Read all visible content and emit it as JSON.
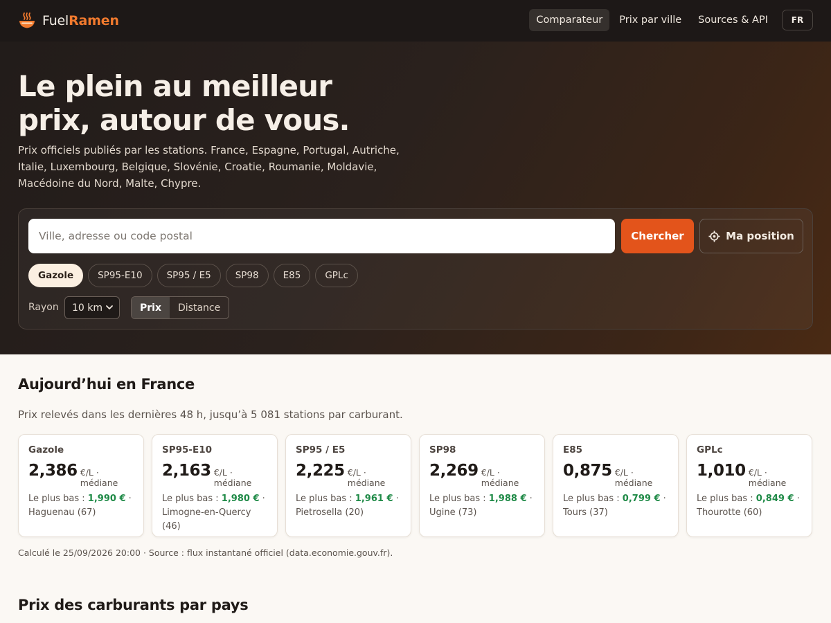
{
  "brand": {
    "name_plain": "Fuel",
    "name_highlight": "Ramen"
  },
  "nav": {
    "items": [
      {
        "label": "Comparateur",
        "active": true
      },
      {
        "label": "Prix par ville",
        "active": false
      },
      {
        "label": "Sources & API",
        "active": false
      }
    ],
    "lang": "FR"
  },
  "hero": {
    "title_line1": "Le plein au meilleur",
    "title_line2": "prix, autour de vous.",
    "subtitle": "Prix officiels publiés par les stations. France, Espagne, Portugal, Autriche, Italie, Luxembourg, Belgique, Slovénie, Croatie, Roumanie, Moldavie, Macédoine du Nord, Malte, Chypre."
  },
  "search": {
    "placeholder": "Ville, adresse ou code postal",
    "value": "",
    "submit_label": "Chercher",
    "position_label": "Ma position",
    "fuels": [
      {
        "label": "Gazole",
        "active": true
      },
      {
        "label": "SP95-E10",
        "active": false
      },
      {
        "label": "SP95 / E5",
        "active": false
      },
      {
        "label": "SP98",
        "active": false
      },
      {
        "label": "E85",
        "active": false
      },
      {
        "label": "GPLc",
        "active": false
      }
    ],
    "radius_label": "Rayon",
    "radius_value": "10 km",
    "sort_options": [
      {
        "label": "Prix",
        "active": true
      },
      {
        "label": "Distance",
        "active": false
      }
    ]
  },
  "today": {
    "title": "Aujourd’hui en France",
    "subtitle": "Prix relevés dans les dernières 48 h, jusqu’à 5 081 stations par carburant.",
    "unit_label": "€/L · médiane",
    "lowest_label": "Le plus bas : ",
    "cards": [
      {
        "fuel": "Gazole",
        "median": "2,386",
        "lowest": "1,990 €",
        "location": "Haguenau (67)"
      },
      {
        "fuel": "SP95-E10",
        "median": "2,163",
        "lowest": "1,980 €",
        "location": "Limogne-en-Quercy (46)"
      },
      {
        "fuel": "SP95 / E5",
        "median": "2,225",
        "lowest": "1,961 €",
        "location": "Pietrosella (20)"
      },
      {
        "fuel": "SP98",
        "median": "2,269",
        "lowest": "1,988 €",
        "location": "Ugine (73)"
      },
      {
        "fuel": "E85",
        "median": "0,875",
        "lowest": "0,799 €",
        "location": "Tours (37)"
      },
      {
        "fuel": "GPLc",
        "median": "1,010",
        "lowest": "0,849 €",
        "location": "Thourotte (60)"
      }
    ],
    "footnote": "Calculé le 25/09/2026 20:00 · Source : flux instantané officiel (data.economie.gouv.fr)."
  },
  "countries": {
    "title": "Prix des carburants par pays"
  },
  "colors": {
    "accent": "#e3541b",
    "brand_orange": "#f27a2e",
    "low_price_green": "#1f8a47",
    "topbar": "#1d1817"
  },
  "icons": {
    "brand": "ramen-bowl-icon",
    "position": "crosshair-icon",
    "select": "chevron-down-icon"
  }
}
